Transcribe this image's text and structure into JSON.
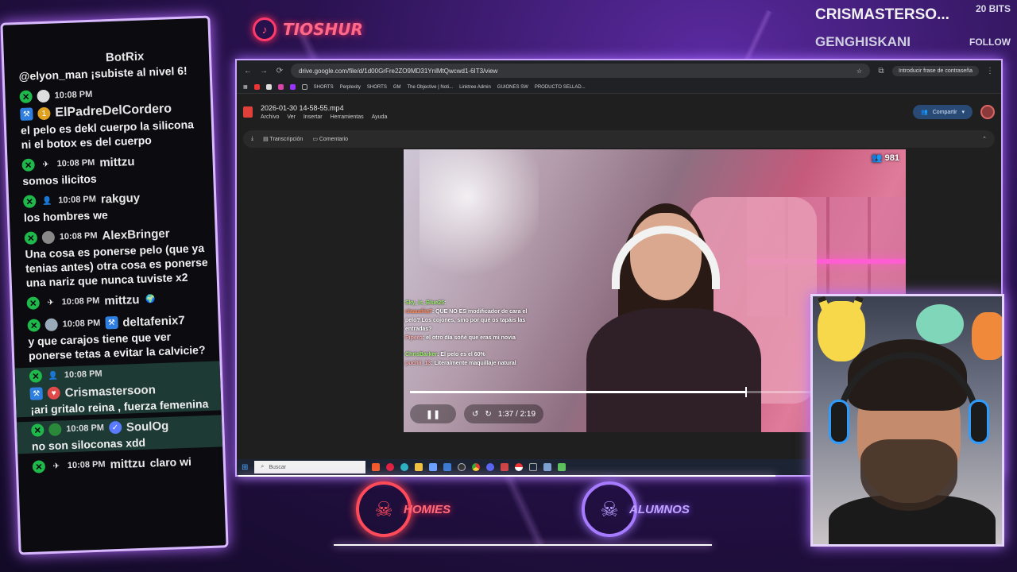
{
  "brand": {
    "name": "TIOSHUR",
    "icon": "tiktok-icon"
  },
  "alerts": {
    "top_name": "CRISMASTERSO...",
    "top_label": "20 BITS",
    "second_name": "GENGHISKANI",
    "second_label": "FOLLOW"
  },
  "chat": {
    "messages": [
      {
        "time": "",
        "user": "BotRix",
        "text": "@elyon_man ¡subiste al nivel 6!",
        "highlight": false
      },
      {
        "time": "10:08 PM",
        "user": "ElPadreDelCordero",
        "text": "el pelo es dekl cuerpo la silicona ni el botox es del cuerpo",
        "highlight": false
      },
      {
        "time": "10:08 PM",
        "user": "mittzu",
        "text": "somos ilicitos",
        "highlight": false
      },
      {
        "time": "10:08 PM",
        "user": "rakguy",
        "text": "los hombres we",
        "highlight": false
      },
      {
        "time": "10:08 PM",
        "user": "AlexBringer",
        "text": "Una cosa es ponerse pelo (que ya tenias antes) otra cosa es ponerse una nariz que nunca tuviste x2",
        "highlight": false
      },
      {
        "time": "10:08 PM",
        "user": "mittzu",
        "text": "",
        "highlight": false
      },
      {
        "time": "10:08 PM",
        "user": "deltafenix7",
        "text": "y que carajos tiene que ver ponerse tetas a evitar la calvicie?",
        "highlight": false
      },
      {
        "time": "10:08 PM",
        "user": "Crismastersoon",
        "text": "¡ari gritalo reina , fuerza femenina",
        "highlight": true
      },
      {
        "time": "10:08 PM",
        "user": "SoulOg",
        "text": "no son siloconas xdd",
        "highlight": true
      },
      {
        "time": "10:08 PM",
        "user": "mittzu",
        "text": "claro wi",
        "highlight": false
      }
    ]
  },
  "browser": {
    "url": "drive.google.com/file/d/1d00GrFre2ZO9MD31YnlMtQwcwd1-6IT3/view",
    "password_chip": "Introducir frase de contraseña",
    "bookmarks": [
      "SHORTS",
      "Perplexity",
      "SHORTS",
      "GM",
      "The Objective | Noti...",
      "Linktree Admin",
      "GUIONES SW",
      "PRODUCTO SELLAD..."
    ],
    "file_title": "2026-01-30 14-58-55.mp4",
    "menu": [
      "Archivo",
      "Ver",
      "Insertar",
      "Herramientas",
      "Ayuda"
    ],
    "share_label": "Compartir",
    "tools": [
      "Transcripción",
      "Comentario"
    ]
  },
  "video": {
    "viewer_count": "981",
    "chat_lines": [
      {
        "user": "Sky_is_Blue25",
        "text": ""
      },
      {
        "user": "claaudiia7",
        "text": "QUE NO ES modificador de cara el pelo? Los cojones, sino por qué os tapáis las entradas?"
      },
      {
        "user": "Pipero",
        "text": "el otro día soñé que eras mi novia"
      },
      {
        "user": "ChrisBarker",
        "text": "El pelo es el 60%"
      },
      {
        "user": "puchii_13",
        "text": "Literalmente maquillaje natural"
      }
    ],
    "time_current": "1:37",
    "time_total": "2:19",
    "progress": 0.68
  },
  "taskbar": {
    "search_placeholder": "Buscar"
  },
  "teams": [
    {
      "name": "HOMIES",
      "color": "#ff4a5a"
    },
    {
      "name": "ALUMNOS",
      "color": "#a77bff"
    }
  ]
}
